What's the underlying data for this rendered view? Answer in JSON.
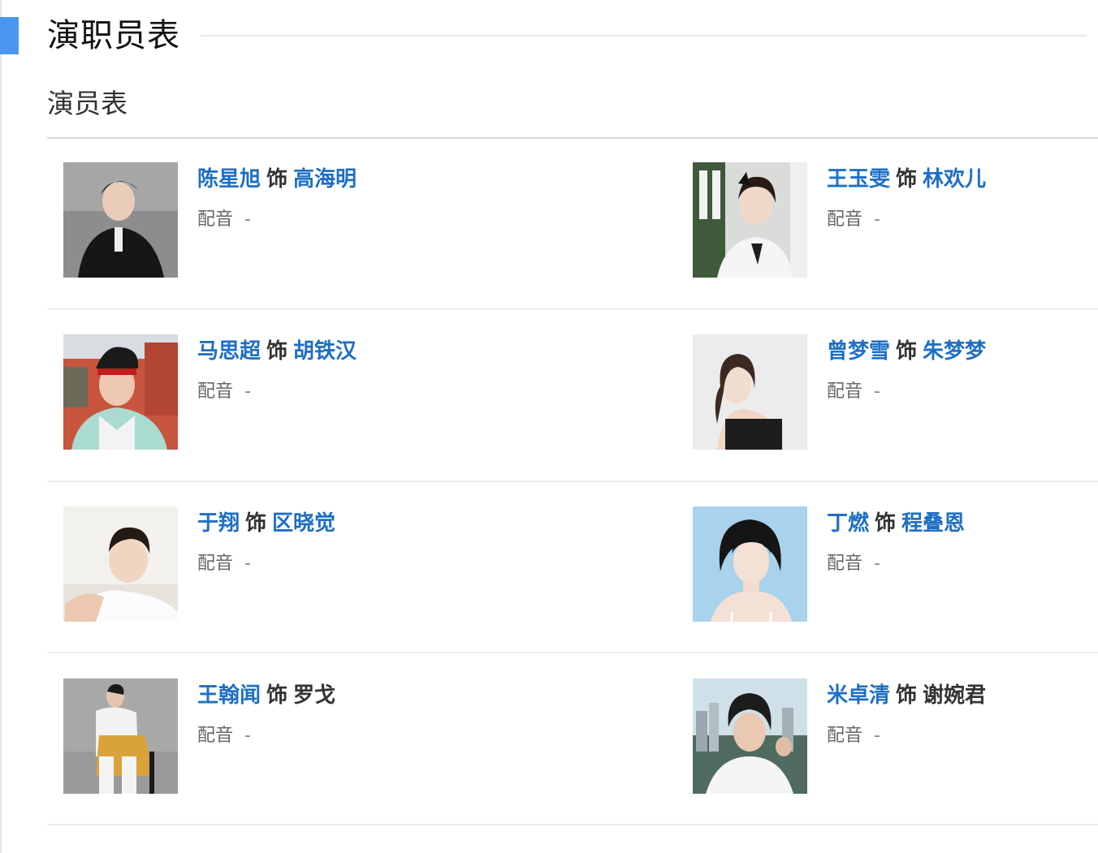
{
  "section": {
    "title": "演职员表",
    "subtitle": "演员表"
  },
  "colors": {
    "accent": "#4b97f0",
    "link": "#1e6fc4"
  },
  "cast": [
    {
      "actor": "陈星旭",
      "as_word": "饰",
      "role": "高海明",
      "voice_label": "配音",
      "voice_value": "-"
    },
    {
      "actor": "王玉雯",
      "as_word": "饰",
      "role": "林欢儿",
      "voice_label": "配音",
      "voice_value": "-"
    },
    {
      "actor": "马思超",
      "as_word": "饰",
      "role": "胡铁汉",
      "voice_label": "配音",
      "voice_value": "-"
    },
    {
      "actor": "曾梦雪",
      "as_word": "饰",
      "role": "朱梦梦",
      "voice_label": "配音",
      "voice_value": "-"
    },
    {
      "actor": "于翔",
      "as_word": "饰",
      "role": "区晓觉",
      "voice_label": "配音",
      "voice_value": "-"
    },
    {
      "actor": "丁燃",
      "as_word": "饰",
      "role": "程叠恩",
      "voice_label": "配音",
      "voice_value": "-"
    },
    {
      "actor": "王翰闻",
      "as_word": "饰",
      "role": "罗戈",
      "voice_label": "配音",
      "voice_value": "-"
    },
    {
      "actor": "米卓清",
      "as_word": "饰",
      "role": "谢婉君",
      "voice_label": "配音",
      "voice_value": "-"
    }
  ]
}
